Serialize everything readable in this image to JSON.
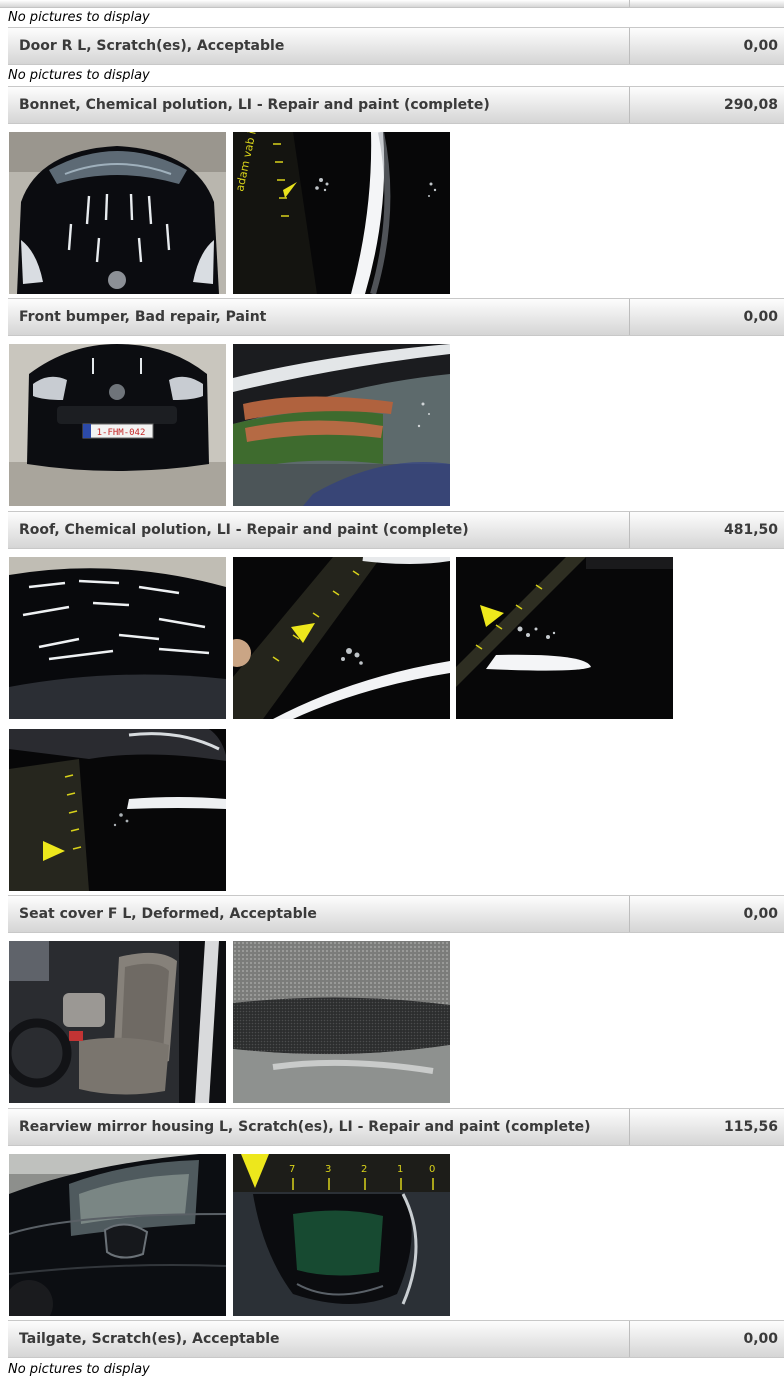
{
  "no_pictures_text": "No pictures to display",
  "damages": [
    {
      "description": "Door R L, Scratch(es), Acceptable",
      "amount": "0,00",
      "photos": []
    },
    {
      "description": "Bonnet, Chemical polution, LI - Repair and paint (complete)",
      "amount": "290,08",
      "photos": [
        "car-front-hood-photo",
        "hood-damage-closeup-photo"
      ]
    },
    {
      "description": "Front bumper, Bad repair, Paint",
      "amount": "0,00",
      "photos": [
        "front-bumper-photo",
        "bumper-reflection-closeup-photo"
      ]
    },
    {
      "description": "Roof, Chemical polution, LI - Repair and paint (complete)",
      "amount": "481,50",
      "photos": [
        "roof-photo",
        "roof-damage-closeup-photo-1",
        "roof-damage-closeup-photo-2",
        "roof-damage-closeup-photo-3"
      ]
    },
    {
      "description": "Seat cover F L, Deformed, Acceptable",
      "amount": "0,00",
      "photos": [
        "seat-front-left-photo",
        "seat-cover-closeup-photo"
      ]
    },
    {
      "description": "Rearview mirror housing L, Scratch(es), LI - Repair and paint (complete)",
      "amount": "115,56",
      "photos": [
        "mirror-housing-photo",
        "mirror-scratch-closeup-photo"
      ]
    },
    {
      "description": "Tailgate, Scratch(es), Acceptable",
      "amount": "0,00",
      "photos": []
    }
  ],
  "photo_labels": {
    "plate_text": "1-FHM-042",
    "ruler_text": "adam vab inspectie",
    "ruler_digits": [
      "7",
      "3",
      "2",
      "1",
      "0"
    ]
  }
}
